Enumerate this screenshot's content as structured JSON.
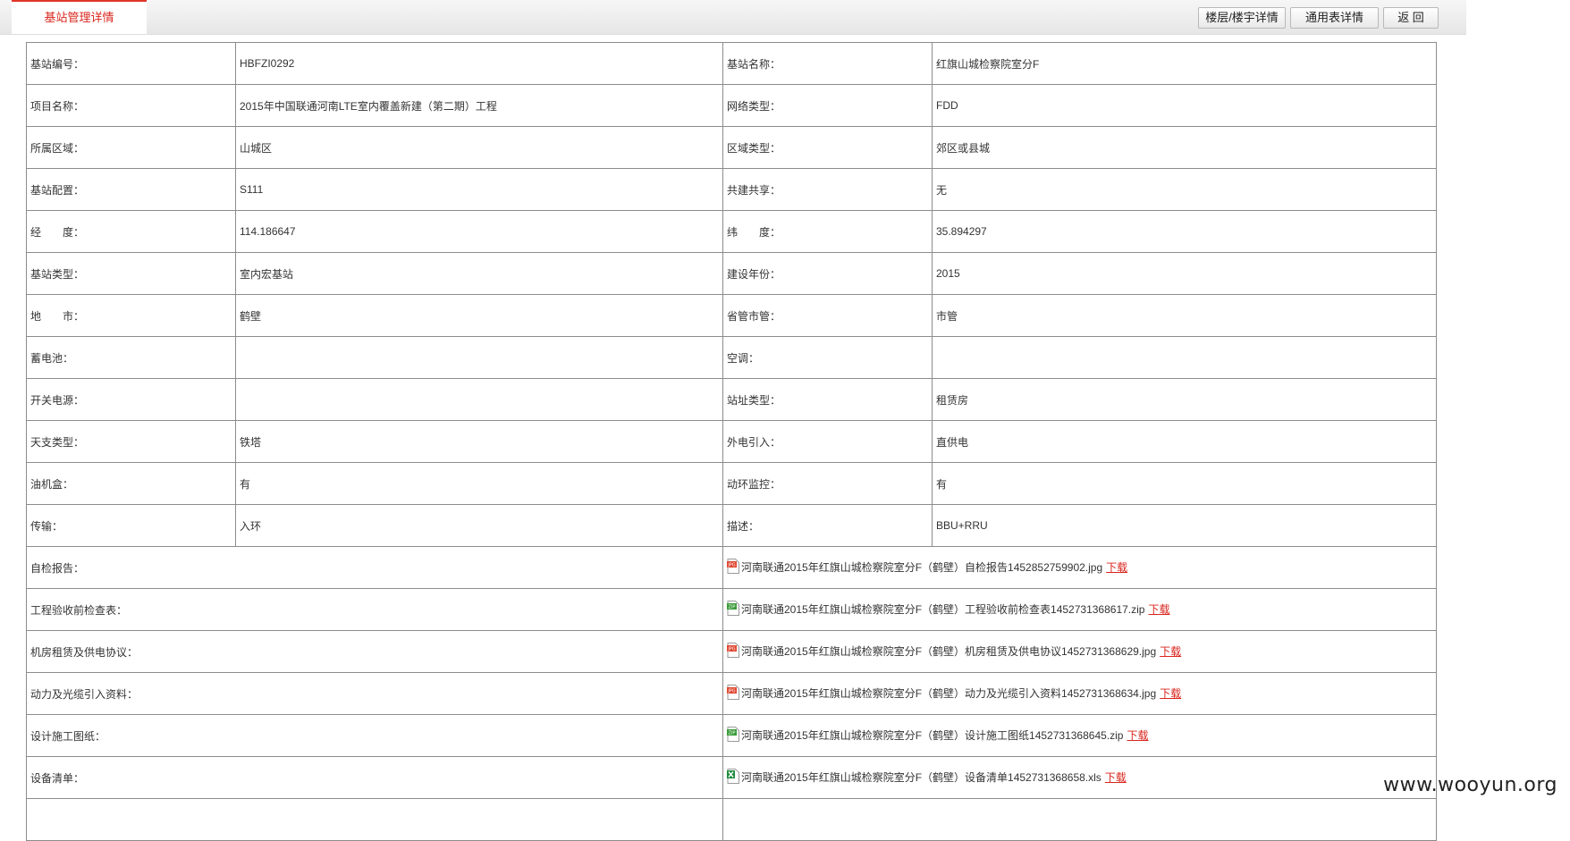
{
  "header": {
    "tab_title": "基站管理详情",
    "buttons": {
      "floor_detail": "楼层/楼宇详情",
      "common_table": "通用表详情",
      "back": "返 回"
    }
  },
  "rows": [
    {
      "l1": "基站编号：",
      "v1": "HBFZI0292",
      "l2": "基站名称：",
      "v2": "红旗山城检察院室分F"
    },
    {
      "l1": "项目名称：",
      "v1": "2015年中国联通河南LTE室内覆盖新建（第二期）工程",
      "l2": "网络类型：",
      "v2": "FDD"
    },
    {
      "l1": "所属区域：",
      "v1": "山城区",
      "l2": "区域类型：",
      "v2": "郊区或县城"
    },
    {
      "l1": "基站配置：",
      "v1": "S111",
      "l2": "共建共享：",
      "v2": "无"
    },
    {
      "l1": "经　　度：",
      "v1": "114.186647",
      "l2": "纬　　度：",
      "v2": "35.894297"
    },
    {
      "l1": "基站类型：",
      "v1": "室内宏基站",
      "l2": "建设年份：",
      "v2": "2015"
    },
    {
      "l1": "地　　市：",
      "v1": "鹤壁",
      "l2": "省管市管：",
      "v2": "市管"
    },
    {
      "l1": "蓄电池：",
      "v1": "",
      "l2": "空调：",
      "v2": ""
    },
    {
      "l1": "开关电源：",
      "v1": "",
      "l2": "站址类型：",
      "v2": "租赁房"
    },
    {
      "l1": "天支类型：",
      "v1": "铁塔",
      "l2": "外电引入：",
      "v2": "直供电"
    },
    {
      "l1": "油机盒：",
      "v1": "有",
      "l2": "动环监控：",
      "v2": "有"
    },
    {
      "l1": "传输：",
      "v1": "入环",
      "l2": "描述：",
      "v2": "BBU+RRU"
    }
  ],
  "files": [
    {
      "label": "自检报告：",
      "icon": "jpg-file-icon",
      "name": "河南联通2015年红旗山城检察院室分F（鹤壁）自检报告1452852759902.jpg",
      "action": "下载"
    },
    {
      "label": "工程验收前检查表：",
      "icon": "zip-file-icon",
      "name": "河南联通2015年红旗山城检察院室分F（鹤壁）工程验收前检查表1452731368617.zip",
      "action": "下载"
    },
    {
      "label": "机房租赁及供电协议：",
      "icon": "jpg-file-icon",
      "name": "河南联通2015年红旗山城检察院室分F（鹤壁）机房租赁及供电协议1452731368629.jpg",
      "action": "下载"
    },
    {
      "label": "动力及光缆引入资料：",
      "icon": "jpg-file-icon",
      "name": "河南联通2015年红旗山城检察院室分F（鹤壁）动力及光缆引入资料1452731368634.jpg",
      "action": "下载"
    },
    {
      "label": "设计施工图纸：",
      "icon": "zip-file-icon",
      "name": "河南联通2015年红旗山城检察院室分F（鹤壁）设计施工图纸1452731368645.zip",
      "action": "下载"
    },
    {
      "label": "设备清单：",
      "icon": "xls-file-icon",
      "name": "河南联通2015年红旗山城检察院室分F（鹤壁）设备清单1452731368658.xls",
      "action": "下载"
    }
  ],
  "watermark": "www.wooyun.org",
  "colors": {
    "accent": "#d9251d",
    "jpg_icon": "#e0452f",
    "zip_icon": "#3a9b3a",
    "xls_icon": "#1e8a3c"
  }
}
